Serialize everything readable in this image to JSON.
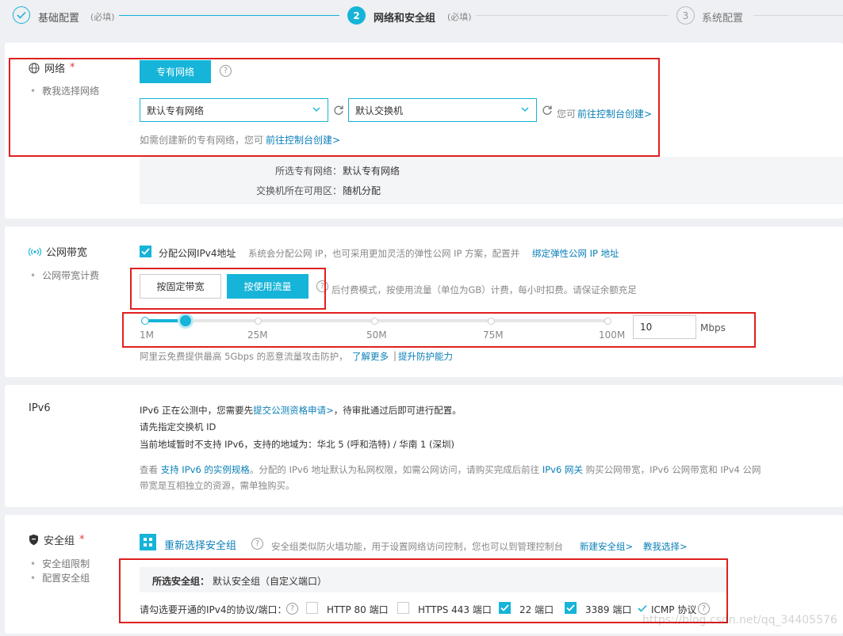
{
  "steps": [
    {
      "label": "基础配置",
      "note": "(必填)",
      "state": "done"
    },
    {
      "number": "2",
      "label": "网络和安全组",
      "note": "(必填)",
      "state": "active"
    },
    {
      "number": "3",
      "label": "系统配置",
      "state": "pending"
    }
  ],
  "network": {
    "title": "网络",
    "required": "*",
    "guide": "教我选择网络",
    "vpc_button": "专有网络",
    "vpc_select": "默认专有网络",
    "vswitch_select": "默认交换机",
    "you_can": "您可",
    "console_link": "前往控制台创建>",
    "hint": "如需创建新的专有网络，您可",
    "hint_link": "前往控制台创建>",
    "summary": [
      {
        "key": "所选专有网络：",
        "value": "默认专有网络"
      },
      {
        "key": "交换机所在可用区：",
        "value": "随机分配"
      }
    ]
  },
  "bandwidth": {
    "title": "公网带宽",
    "guide": "公网带宽计费",
    "assign_ipv4_label": "分配公网IPv4地址",
    "assign_ipv4_checked": true,
    "assign_desc": "系统会分配公网 IP，也可采用更加灵活的弹性公网 IP 方案，配置并",
    "assign_link": "绑定弹性公网 IP 地址",
    "fixed_button": "按固定带宽",
    "traffic_button": "按使用流量",
    "traffic_desc": "后付费模式，按使用流量（单位为GB）计费，每小时扣费。请保证余额充足",
    "slider_ticks": [
      "1M",
      "25M",
      "50M",
      "75M",
      "100M"
    ],
    "slider_fraction": 0.05,
    "value": "10",
    "unit": "Mbps",
    "protect_text": "阿里云免费提供最高 5Gbps 的恶意流量攻击防护，",
    "learn_more": "了解更多",
    "separator": "|",
    "upgrade": "提升防护能力"
  },
  "ipv6": {
    "title": "IPv6",
    "line1_pre": "IPv6 正在公测中，您需要先",
    "line1_link": "提交公测资格申请>",
    "line1_post": "，待审批通过后即可进行配置。",
    "line2": "请先指定交换机 ID",
    "line3": "当前地域暂时不支持 IPv6，支持的地域为：华北 5 (呼和浩特) / 华南 1 (深圳)",
    "line4_a": "查看",
    "line4_link1": "支持 IPv6 的实例规格",
    "line4_b": "。分配的 IPv6 地址默认为私网权限，如需公网访问，请购买完成后前往",
    "line4_link2": "IPv6 网关",
    "line4_c": "购买公网带宽，IPv6 公网带宽和 IPv4 公网",
    "line5": "带宽是互相独立的资源，需单独购买。"
  },
  "security": {
    "title": "安全组",
    "required": "*",
    "guide1": "安全组限制",
    "guide2": "配置安全组",
    "reselect": "重新选择安全组",
    "desc": "安全组类似防火墙功能，用于设置网络访问控制，您也可以到管理控制台",
    "new_link": "新建安全组>",
    "teach_link": "教我选择>",
    "selected_key": "所选安全组：",
    "selected_value": "默认安全组（自定义端口）",
    "ports_label": "请勾选要开通的IPv4的协议/端口：",
    "ports": [
      {
        "label": "HTTP 80 端口",
        "checked": false
      },
      {
        "label": "HTTPS 443 端口",
        "checked": false
      },
      {
        "label": "22 端口",
        "checked": true
      },
      {
        "label": "3389 端口",
        "checked": true
      }
    ],
    "icmp": "ICMP 协议"
  },
  "watermark": "https://blog.csdn.net/qq_34405576",
  "colors": {
    "accent": "#16b4d8",
    "link": "#0a7fb8",
    "highlight": "#e02020"
  }
}
